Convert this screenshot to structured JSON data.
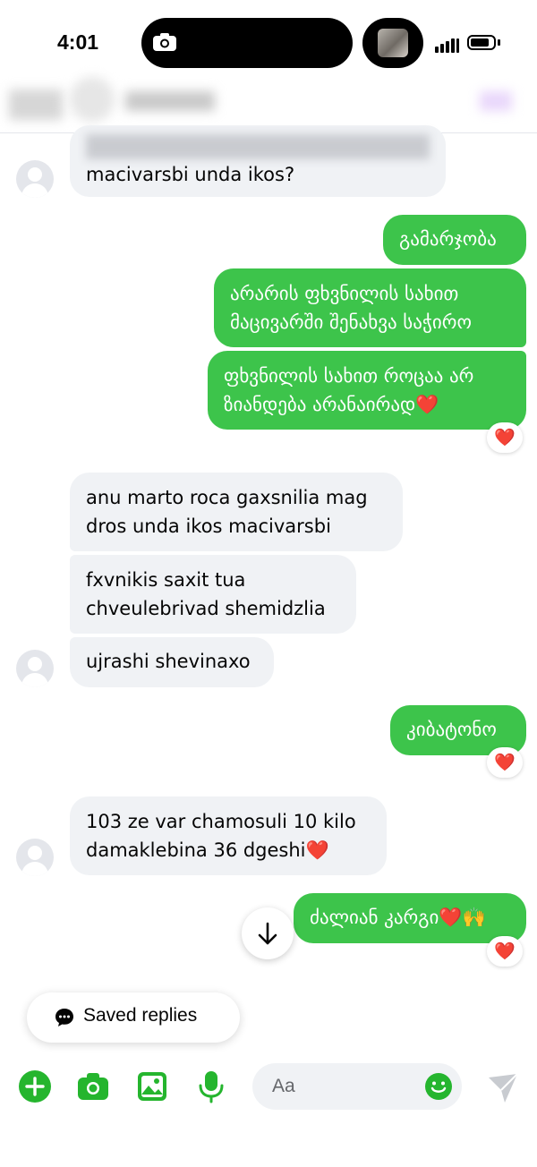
{
  "status_bar": {
    "time": "4:01"
  },
  "colors": {
    "outgoing_bubble": "#3dc44b",
    "incoming_bubble": "#f0f2f5",
    "accent": "#25b52e",
    "heart": "#e41e3f"
  },
  "messages": [
    {
      "dir": "in",
      "text": "macivarsbi unda ikos?"
    },
    {
      "dir": "out",
      "text": "გამარჯობა"
    },
    {
      "dir": "out",
      "text": "არარის ფხვნილის სახით მაცივარში შენახვა საჭირო"
    },
    {
      "dir": "out",
      "text": "ფხვნილის სახით როცაა არ ზიანდება არანაირად❤️",
      "reaction": "❤️"
    },
    {
      "dir": "in",
      "text": "anu marto roca gaxsnilia mag dros unda ikos macivarsbi"
    },
    {
      "dir": "in",
      "text": "fxvnikis saxit tua chveulebrivad shemidzlia"
    },
    {
      "dir": "in",
      "text": "ujrashi shevinaxo"
    },
    {
      "dir": "out",
      "text": "კიბატონო",
      "reaction": "❤️"
    },
    {
      "dir": "in",
      "text": "103 ze var chamosuli 10 kilo damaklebina 36 dgeshi❤️"
    },
    {
      "dir": "out",
      "text": "ძალიან კარგი❤️🙌",
      "reaction": "❤️"
    }
  ],
  "saved_replies": {
    "label": "Saved replies"
  },
  "composer": {
    "placeholder": "Aa",
    "icons": [
      "plus-icon",
      "camera-icon",
      "gallery-icon",
      "microphone-icon",
      "emoji-icon",
      "send-icon"
    ]
  }
}
